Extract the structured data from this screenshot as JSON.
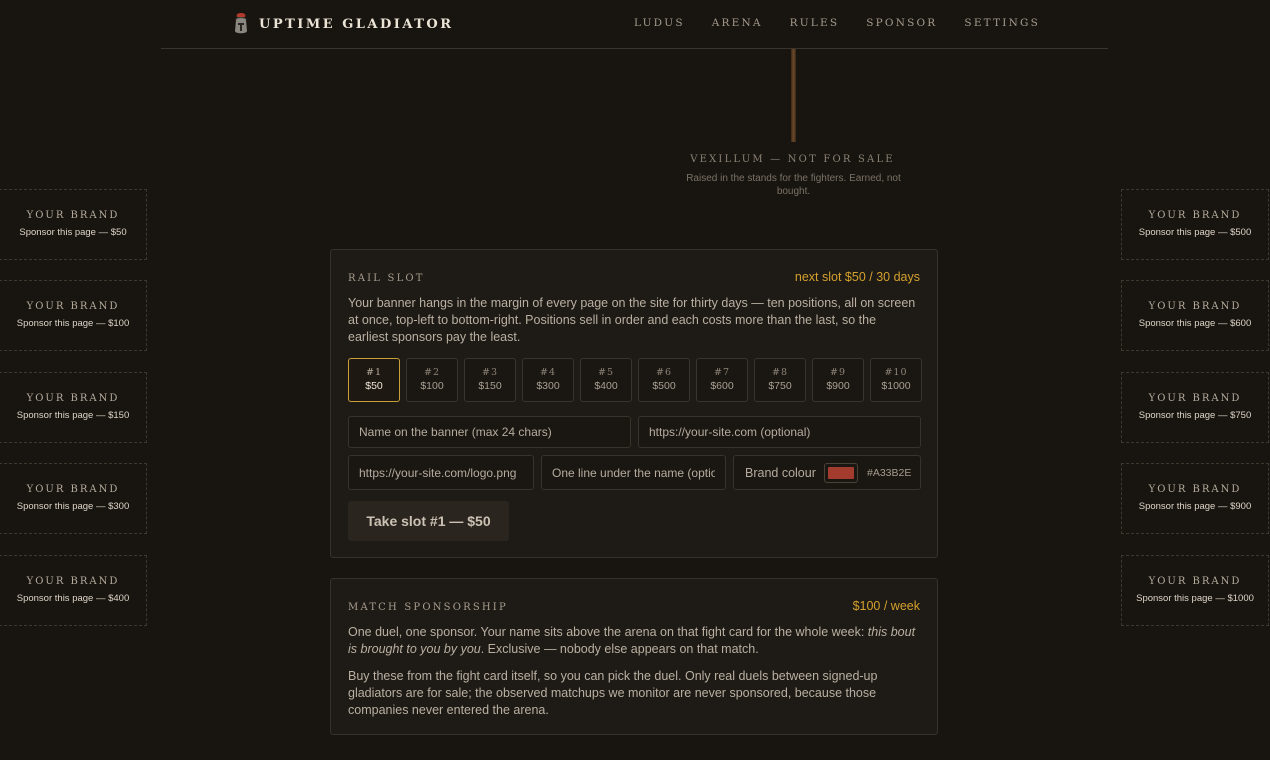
{
  "header": {
    "brand": "UPTIME GLADIATOR",
    "nav": [
      "LUDUS",
      "ARENA",
      "RULES",
      "SPONSOR",
      "SETTINGS"
    ]
  },
  "vexillum": {
    "title": "VEXILLUM — NOT FOR SALE",
    "subtitle": "Raised in the stands for the fighters. Earned, not bought."
  },
  "rail_left": [
    {
      "brand": "YOUR BRAND",
      "text": "Sponsor this page — $50"
    },
    {
      "brand": "YOUR BRAND",
      "text": "Sponsor this page — $100"
    },
    {
      "brand": "YOUR BRAND",
      "text": "Sponsor this page — $150"
    },
    {
      "brand": "YOUR BRAND",
      "text": "Sponsor this page — $300"
    },
    {
      "brand": "YOUR BRAND",
      "text": "Sponsor this page — $400"
    }
  ],
  "rail_right": [
    {
      "brand": "YOUR BRAND",
      "text": "Sponsor this page — $500"
    },
    {
      "brand": "YOUR BRAND",
      "text": "Sponsor this page — $600"
    },
    {
      "brand": "YOUR BRAND",
      "text": "Sponsor this page — $750"
    },
    {
      "brand": "YOUR BRAND",
      "text": "Sponsor this page — $900"
    },
    {
      "brand": "YOUR BRAND",
      "text": "Sponsor this page — $1000"
    }
  ],
  "rail_slot": {
    "title": "RAIL SLOT",
    "price": "next slot $50 / 30 days",
    "description": "Your banner hangs in the margin of every page on the site for thirty days — ten positions, all on screen at once, top-left to bottom-right. Positions sell in order and each costs more than the last, so the earliest sponsors pay the least.",
    "slots": [
      {
        "num": "#1",
        "price": "$50"
      },
      {
        "num": "#2",
        "price": "$100"
      },
      {
        "num": "#3",
        "price": "$150"
      },
      {
        "num": "#4",
        "price": "$300"
      },
      {
        "num": "#5",
        "price": "$400"
      },
      {
        "num": "#6",
        "price": "$500"
      },
      {
        "num": "#7",
        "price": "$600"
      },
      {
        "num": "#8",
        "price": "$750"
      },
      {
        "num": "#9",
        "price": "$900"
      },
      {
        "num": "#10",
        "price": "$1000"
      }
    ],
    "name_placeholder": "Name on the banner (max 24 chars)",
    "url_placeholder": "https://your-site.com (optional)",
    "logo_placeholder": "https://your-site.com/logo.png",
    "tagline_placeholder": "One line under the name (optional)",
    "colour_label": "Brand colour",
    "colour_hex": "#A33B2E",
    "colour_value": "#A33B2E",
    "button": "Take slot #1 — $50"
  },
  "match": {
    "title": "MATCH SPONSORSHIP",
    "price": "$100 / week",
    "p1_a": "One duel, one sponsor. Your name sits above the arena on that fight card for the whole week: ",
    "p1_em": "this bout is brought to you by you",
    "p1_b": ". Exclusive — nobody else appears on that match.",
    "p2": "Buy these from the fight card itself, so you can pick the duel. Only real duels between signed-up gladiators are for sale; the observed matchups we monitor are never sponsored, because those companies never entered the arena."
  }
}
